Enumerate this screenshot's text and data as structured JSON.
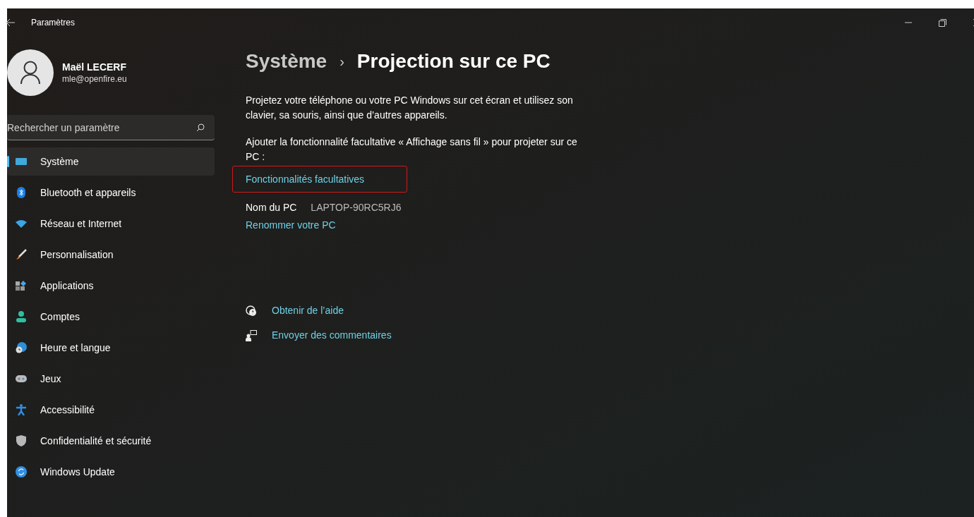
{
  "window": {
    "title": "Paramètres"
  },
  "user": {
    "name": "Maël LECERF",
    "email": "mle@openfire.eu"
  },
  "search": {
    "placeholder": "Rechercher un paramètre"
  },
  "sidebar": {
    "items": [
      {
        "label": "Système",
        "kind": "system",
        "selected": true
      },
      {
        "label": "Bluetooth et appareils",
        "kind": "bluetooth",
        "selected": false
      },
      {
        "label": "Réseau et Internet",
        "kind": "network",
        "selected": false
      },
      {
        "label": "Personnalisation",
        "kind": "brush",
        "selected": false
      },
      {
        "label": "Applications",
        "kind": "apps",
        "selected": false
      },
      {
        "label": "Comptes",
        "kind": "accounts",
        "selected": false
      },
      {
        "label": "Heure et langue",
        "kind": "time",
        "selected": false
      },
      {
        "label": "Jeux",
        "kind": "games",
        "selected": false
      },
      {
        "label": "Accessibilité",
        "kind": "accessibility",
        "selected": false
      },
      {
        "label": "Confidentialité et sécurité",
        "kind": "privacy",
        "selected": false
      },
      {
        "label": "Windows Update",
        "kind": "update",
        "selected": false
      }
    ]
  },
  "breadcrumb": {
    "parent": "Système",
    "separator": "›",
    "current": "Projection sur ce PC"
  },
  "description": "Projetez votre téléphone ou votre PC Windows sur cet écran et utilisez son clavier, sa souris, ainsi que d’autres appareils.",
  "feature_note": "Ajouter la fonctionnalité facultative « Affichage sans fil » pour projeter sur ce PC :",
  "feature_link": {
    "label": "Fonctionnalités facultatives",
    "highlighted": true
  },
  "pc_name": {
    "label": "Nom du PC",
    "value": "LAPTOP-90RC5RJ6"
  },
  "rename_link": "Renommer votre PC",
  "help_links": [
    {
      "label": "Obtenir de l’aide",
      "kind": "help"
    },
    {
      "label": "Envoyer des commentaires",
      "kind": "feedback"
    }
  ]
}
